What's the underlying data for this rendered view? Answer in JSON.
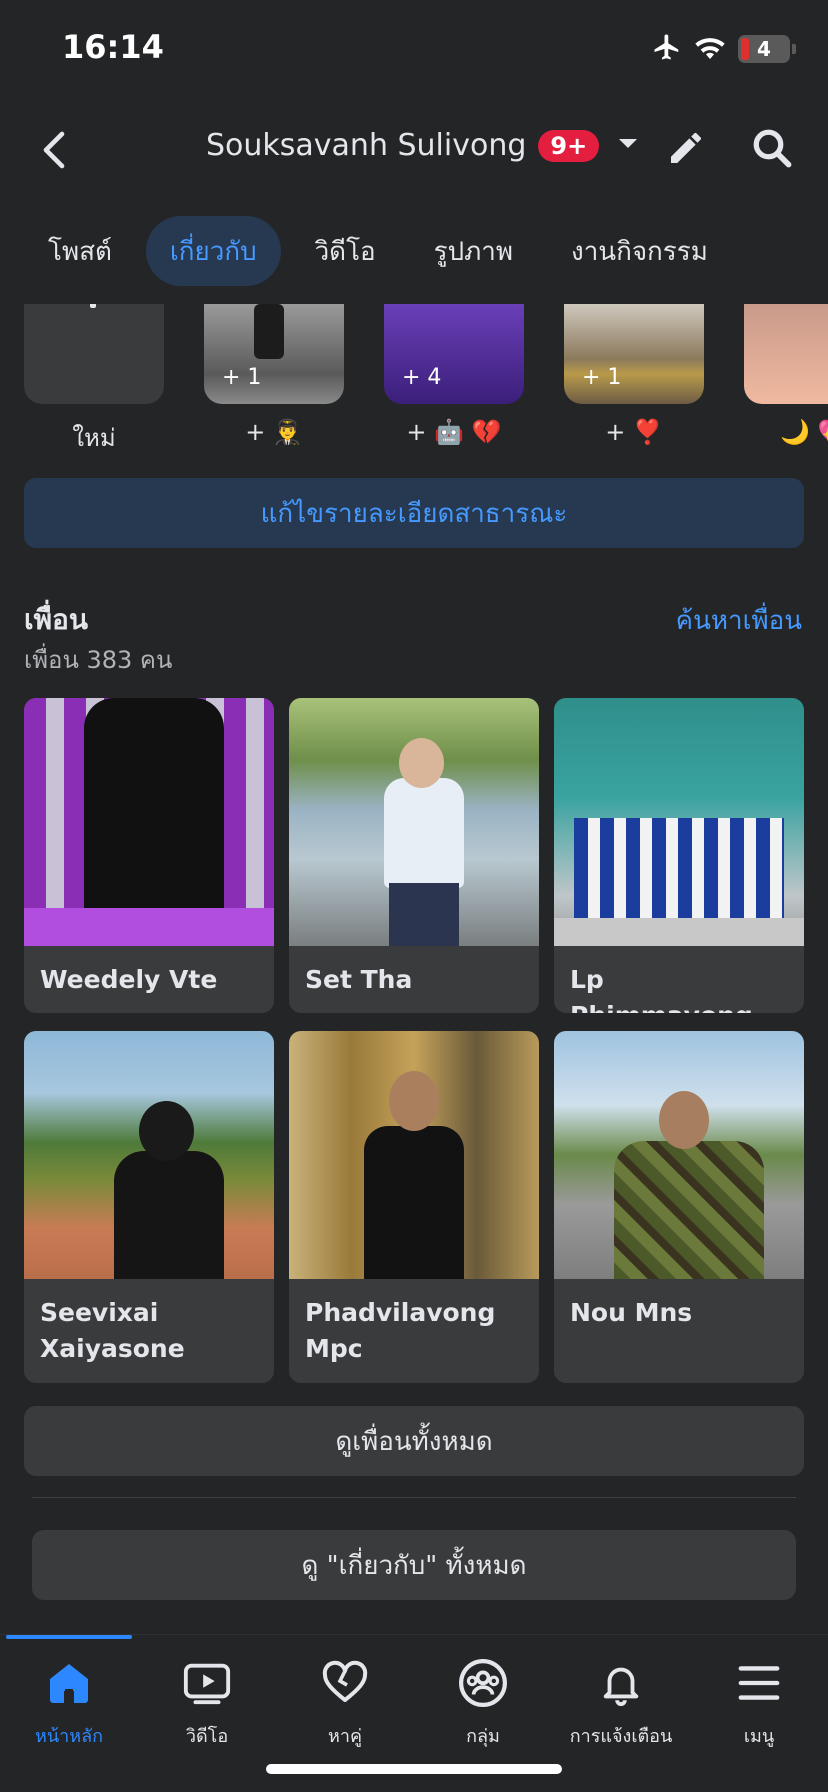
{
  "status_bar": {
    "time": "16:14",
    "battery": "4"
  },
  "header": {
    "profile_name": "Souksavanh Sulivong",
    "notification_badge": "9+"
  },
  "tabs": [
    {
      "label": "โพสต์",
      "active": false
    },
    {
      "label": "เกี่ยวกับ",
      "active": true
    },
    {
      "label": "วิดีโอ",
      "active": false
    },
    {
      "label": "รูปภาพ",
      "active": false
    },
    {
      "label": "งานกิจกรรม",
      "active": false
    }
  ],
  "featured": [
    {
      "label": "ใหม่",
      "count": ""
    },
    {
      "label": "+ 👨‍✈️",
      "count": "+ 1"
    },
    {
      "label": "+ 🤖 💔",
      "count": "+ 4"
    },
    {
      "label": "+ ❣️",
      "count": "+ 1"
    },
    {
      "label": "🌙 💖",
      "count": ""
    }
  ],
  "edit_details_label": "แก้ไขรายละเอียดสาธารณะ",
  "friends": {
    "title": "เพื่อน",
    "count_text": "เพื่อน 383 คน",
    "find_link": "ค้นหาเพื่อน",
    "items": [
      {
        "name": "Weedely Vte"
      },
      {
        "name": "Set Tha"
      },
      {
        "name": "Lp Phimmavong"
      },
      {
        "name": "Seevixai Xaiyasone"
      },
      {
        "name": "Phadvilavong Mpc"
      },
      {
        "name": "Nou Mns"
      }
    ],
    "see_all_label": "ดูเพื่อนทั้งหมด"
  },
  "see_all_about_label": "ดู \"เกี่ยวกับ\" ทั้งหมด",
  "bottom_nav": [
    {
      "label": "หน้าหลัก",
      "icon": "home-icon",
      "active": true
    },
    {
      "label": "วิดีโอ",
      "icon": "video-icon",
      "active": false
    },
    {
      "label": "หาคู่",
      "icon": "dating-heart-icon",
      "active": false
    },
    {
      "label": "กลุ่ม",
      "icon": "groups-icon",
      "active": false
    },
    {
      "label": "การแจ้งเตือน",
      "icon": "bell-icon",
      "active": false
    },
    {
      "label": "เมนู",
      "icon": "menu-icon",
      "active": false
    }
  ],
  "colors": {
    "background": "#242526",
    "accent": "#2d88ff",
    "card": "#3a3b3c",
    "badge": "#e41e3f"
  }
}
